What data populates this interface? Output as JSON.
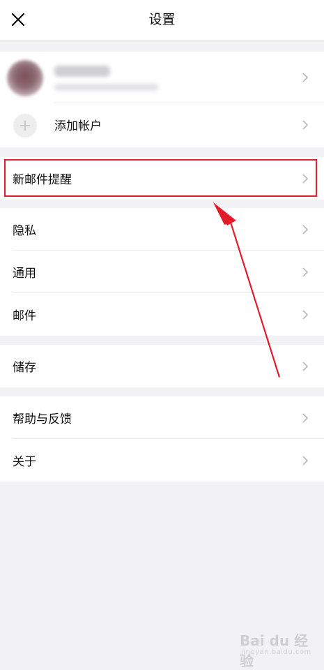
{
  "header": {
    "title": "设置",
    "close_icon": "close-icon"
  },
  "account": {
    "add_account_label": "添加帐户"
  },
  "menu": {
    "new_mail_alert": "新邮件提醒",
    "privacy": "隐私",
    "general": "通用",
    "mail": "邮件",
    "storage": "储存",
    "help_feedback": "帮助与反馈",
    "about": "关于"
  },
  "watermark": {
    "brand": "Bai du 经验",
    "sub": "jingyan.baidu.com"
  },
  "colors": {
    "background": "#f2f2f4",
    "surface": "#ffffff",
    "annotation_red": "#e21c2b",
    "chevron": "#b8b8bd"
  }
}
